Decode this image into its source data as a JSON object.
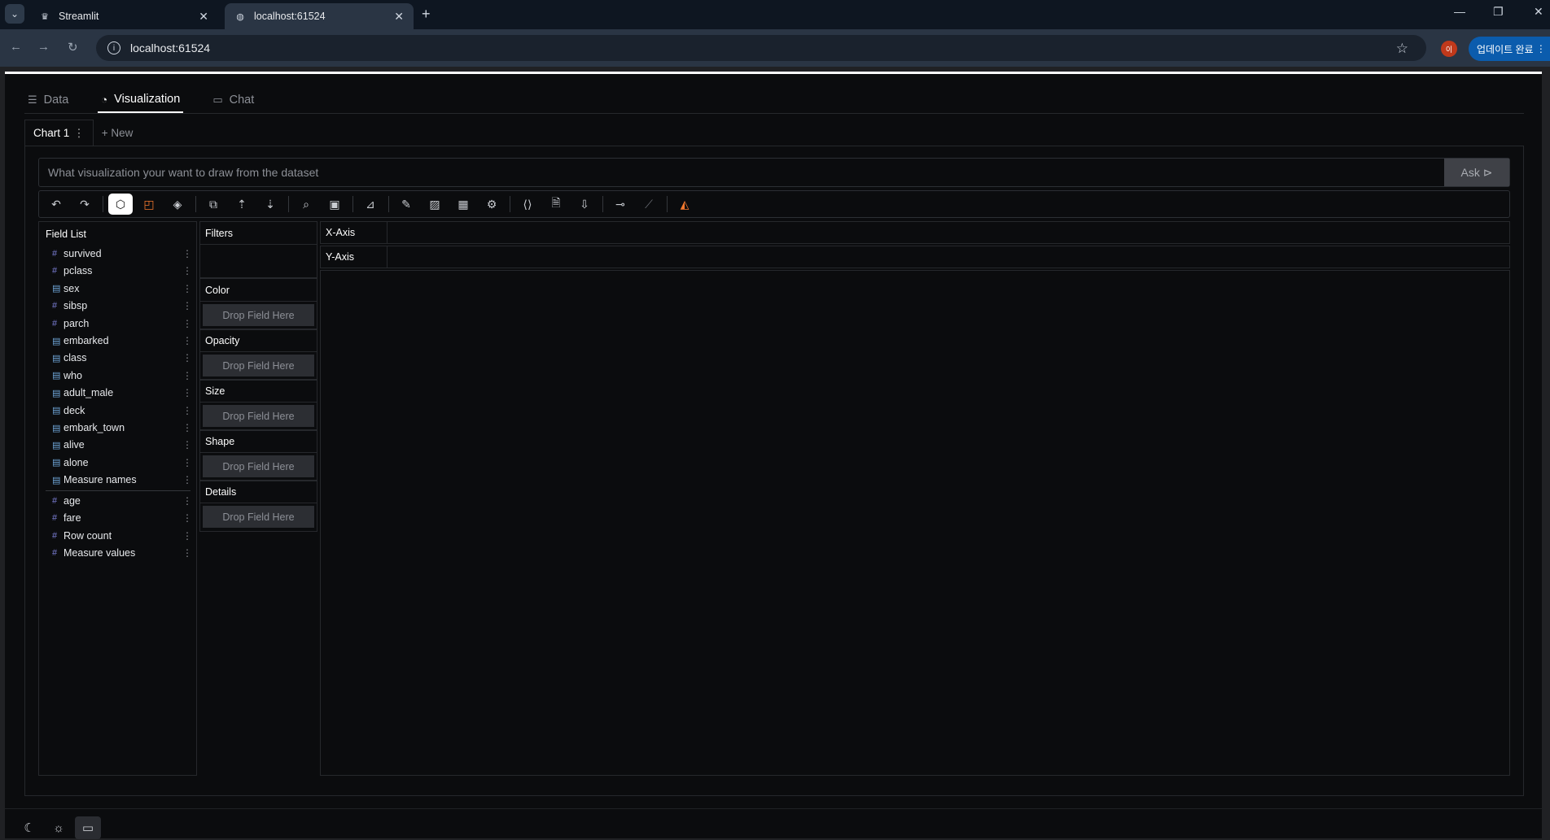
{
  "browser": {
    "tabs": [
      {
        "title": "Streamlit"
      },
      {
        "title": "localhost:61524"
      }
    ],
    "url": "localhost:61524",
    "avatar_letter": "이",
    "update_label": "업데이트 완료"
  },
  "app": {
    "main_tabs": [
      {
        "label": "Data",
        "icon": "database-icon"
      },
      {
        "label": "Visualization",
        "icon": "palette-icon"
      },
      {
        "label": "Chat",
        "icon": "chat-icon"
      }
    ],
    "chart_tab": "Chart 1",
    "chart_tab_menu": "⋮",
    "new_label": "+ New",
    "ask": {
      "placeholder": "What visualization your want to draw from the dataset",
      "button": "Ask ⊳"
    },
    "field_list": {
      "title": "Field List",
      "dimensions": [
        {
          "name": "survived",
          "type": "#"
        },
        {
          "name": "pclass",
          "type": "#"
        },
        {
          "name": "sex",
          "type": "▤"
        },
        {
          "name": "sibsp",
          "type": "#"
        },
        {
          "name": "parch",
          "type": "#"
        },
        {
          "name": "embarked",
          "type": "▤"
        },
        {
          "name": "class",
          "type": "▤"
        },
        {
          "name": "who",
          "type": "▤"
        },
        {
          "name": "adult_male",
          "type": "▤"
        },
        {
          "name": "deck",
          "type": "▤"
        },
        {
          "name": "embark_town",
          "type": "▤"
        },
        {
          "name": "alive",
          "type": "▤"
        },
        {
          "name": "alone",
          "type": "▤"
        },
        {
          "name": "Measure names",
          "type": "▤"
        }
      ],
      "measures": [
        {
          "name": "age",
          "type": "#"
        },
        {
          "name": "fare",
          "type": "#"
        },
        {
          "name": "Row count",
          "type": "#"
        },
        {
          "name": "Measure values",
          "type": "#"
        }
      ]
    },
    "encodings": {
      "filters": "Filters",
      "color": "Color",
      "opacity": "Opacity",
      "size": "Size",
      "shape": "Shape",
      "details": "Details",
      "drop_placeholder": "Drop Field Here"
    },
    "axes": {
      "x": "X-Axis",
      "y": "Y-Axis"
    }
  }
}
